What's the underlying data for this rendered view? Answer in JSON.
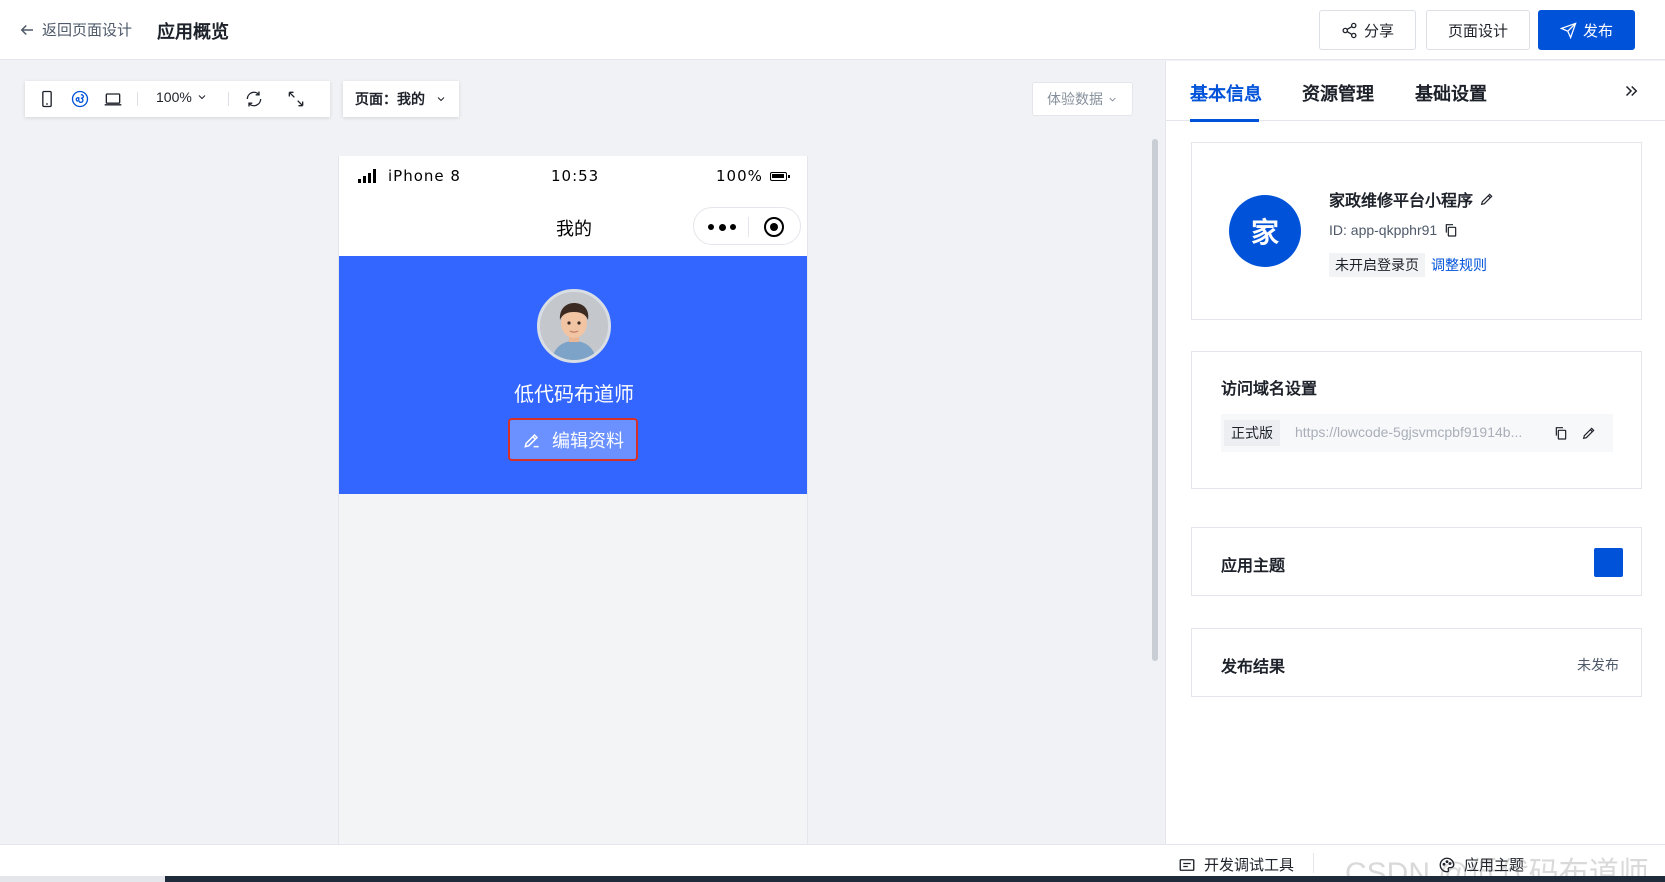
{
  "header": {
    "back_label": "返回页面设计",
    "title": "应用概览",
    "share_label": "分享",
    "design_label": "页面设计",
    "publish_label": "发布"
  },
  "toolbar": {
    "zoom": "100%",
    "page_label": "页面：我的",
    "trial_data_label": "体验数据"
  },
  "phone": {
    "carrier": "iPhone 8",
    "time": "10:53",
    "battery": "100%",
    "nav_title": "我的",
    "username": "低代码布道师",
    "edit_label": "编辑资料"
  },
  "panel": {
    "tabs": [
      {
        "label": "基本信息",
        "active": true
      },
      {
        "label": "资源管理",
        "active": false
      },
      {
        "label": "基础设置",
        "active": false
      }
    ],
    "app": {
      "avatar_char": "家",
      "name": "家政维修平台小程序",
      "id_text": "ID: app-qkpphr91",
      "login_tag": "未开启登录页",
      "login_link": "调整规则"
    },
    "domain": {
      "title": "访问域名设置",
      "tag": "正式版",
      "url": "https://lowcode-5gjsvmcpbf91914b..."
    },
    "theme": {
      "title": "应用主题",
      "color": "#0052d9"
    },
    "result": {
      "title": "发布结果",
      "status": "未发布"
    }
  },
  "bottombar": {
    "devtools_label": "开发调试工具",
    "theme_label": "应用主题",
    "watermark": "CSDN @低代码布道师"
  },
  "colors": {
    "primary": "#0052d9",
    "banner": "#3366ff"
  }
}
